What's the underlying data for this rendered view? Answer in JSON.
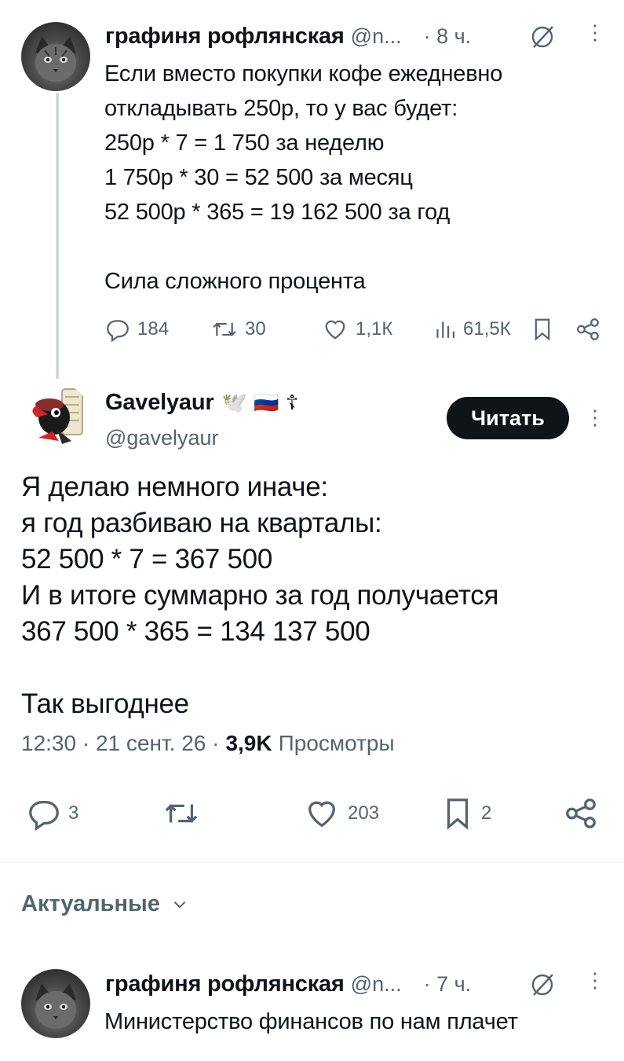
{
  "tweet1": {
    "name": "графиня рофлянская",
    "handle": "@n...",
    "time": "· 8 ч.",
    "text": "Если вместо покупки кофе ежедневно\nоткладывать 250р, то у вас будет:\n250р * 7 = 1 750 за неделю\n1 750р * 30 = 52 500 за месяц\n52 500р * 365 = 19 162 500 за год\n\nСила сложного процента",
    "replies": "184",
    "retweets": "30",
    "likes": "1,1К",
    "views": "61,5К"
  },
  "main_tweet": {
    "name": "Gavelyaur",
    "name_emojis": "🕊️ 🇷🇺 ☦",
    "handle": "@gavelyaur",
    "follow_label": "Читать",
    "text": "Я делаю немного иначе:\nя год разбиваю на кварталы:\n52 500 * 7 = 367 500\nИ в итоге суммарно за год получается\n367 500 * 365 = 134 137 500\n\nТак выгоднее",
    "time": "12:30 · 21 сент. 26 ·",
    "views_count": "3,9K",
    "views_label": "Просмотры",
    "replies": "3",
    "likes": "203",
    "bookmarks": "2"
  },
  "sort": {
    "label": "Актуальные"
  },
  "reply1": {
    "name": "графиня рофлянская",
    "handle": "@n...",
    "time": "· 7 ч.",
    "text": "Министерство финансов по нам плачет"
  },
  "colors": {
    "text": "#0f1419",
    "secondary": "#536471",
    "thread_line": "#cfd9de",
    "button": "#0f1419"
  }
}
